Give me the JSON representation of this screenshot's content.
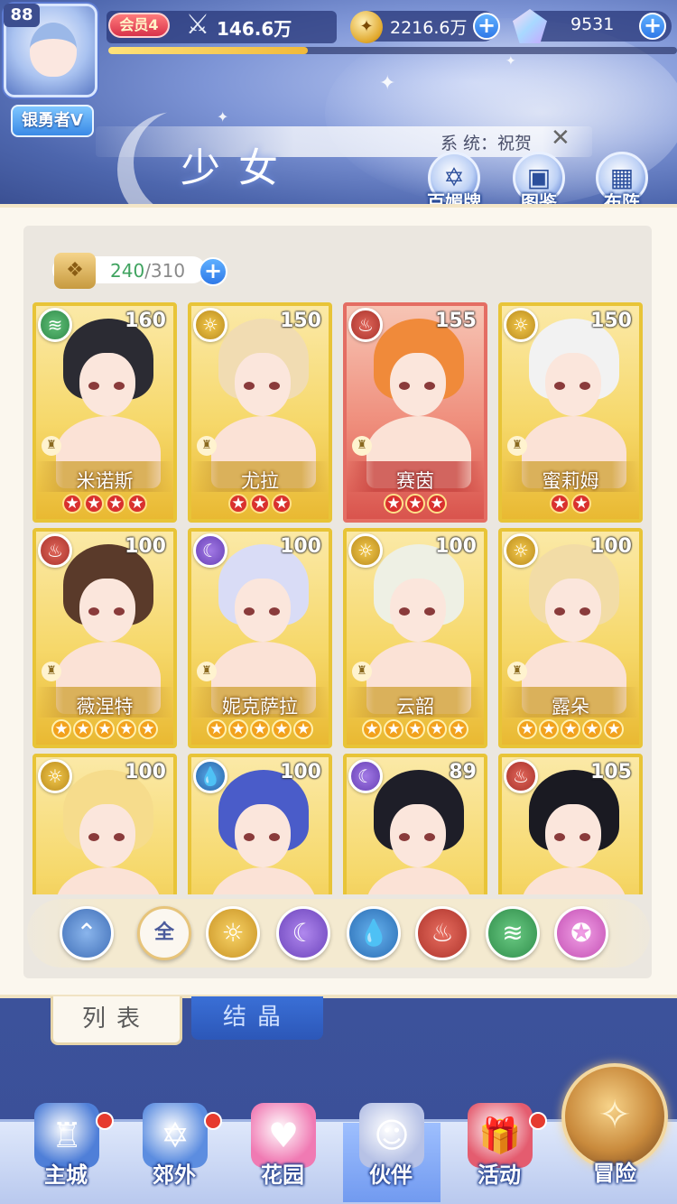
{
  "player": {
    "level": "88",
    "title": "银勇者V",
    "vip": "会员4",
    "power": "146.6万",
    "exp_fraction": 0.35
  },
  "resources": {
    "coins": "2216.6万",
    "gems": "9531",
    "plus_label": "+"
  },
  "system_message": {
    "text": "系  统：祝贺",
    "close_label": "✕"
  },
  "page_title": "少女",
  "functions": [
    {
      "label": "百媚牌",
      "icon": "hexagram-icon"
    },
    {
      "label": "图鉴",
      "icon": "book-icon"
    },
    {
      "label": "布阵",
      "icon": "grid-icon"
    }
  ],
  "capacity": {
    "current": "240",
    "max": "/310",
    "plus_label": "+"
  },
  "cards": [
    {
      "name": "米诺斯",
      "level": "160",
      "element": "wind",
      "stars": 4,
      "star_color": "red",
      "frame": "gold",
      "hair": "#2b2b33"
    },
    {
      "name": "尤拉",
      "level": "150",
      "element": "light",
      "stars": 3,
      "star_color": "red",
      "frame": "gold",
      "hair": "#f1dcb2"
    },
    {
      "name": "赛茵",
      "level": "155",
      "element": "fire",
      "stars": 3,
      "star_color": "red",
      "frame": "red",
      "hair": "#f08a3a"
    },
    {
      "name": "蜜莉姆",
      "level": "150",
      "element": "light",
      "stars": 2,
      "star_color": "red",
      "frame": "gold",
      "hair": "#f2f2f2"
    },
    {
      "name": "薇涅特",
      "level": "100",
      "element": "fire",
      "stars": 5,
      "star_color": "gold",
      "frame": "gold",
      "hair": "#5a3a2a"
    },
    {
      "name": "妮克萨拉",
      "level": "100",
      "element": "moon",
      "stars": 5,
      "star_color": "gold",
      "frame": "gold",
      "hair": "#d9dcf6"
    },
    {
      "name": "云韶",
      "level": "100",
      "element": "light",
      "stars": 5,
      "star_color": "gold",
      "frame": "gold",
      "hair": "#eef0e4"
    },
    {
      "name": "露朵",
      "level": "100",
      "element": "light",
      "stars": 5,
      "star_color": "gold",
      "frame": "gold",
      "hair": "#f2dca6"
    },
    {
      "name": "",
      "level": "100",
      "element": "light",
      "stars": 0,
      "star_color": "gold",
      "frame": "gold",
      "hair": "#f6dc8c"
    },
    {
      "name": "",
      "level": "100",
      "element": "water",
      "stars": 0,
      "star_color": "gold",
      "frame": "gold",
      "hair": "#4a5cc9"
    },
    {
      "name": "",
      "level": "89",
      "element": "moon",
      "stars": 0,
      "star_color": "gold",
      "frame": "gold",
      "hair": "#1e1e28"
    },
    {
      "name": "",
      "level": "105",
      "element": "fire",
      "stars": 0,
      "star_color": "gold",
      "frame": "gold",
      "hair": "#1a1a22"
    }
  ],
  "element_glyphs": {
    "light": "☼",
    "fire": "♨",
    "water": "💧",
    "wind": "≋",
    "moon": "☾"
  },
  "filters": [
    {
      "name": "type-filter",
      "class": "f-type",
      "glyph": "⌃"
    },
    {
      "name": "all-filter",
      "class": "f-all",
      "glyph": "全"
    },
    {
      "name": "light-filter",
      "class": "f-light",
      "glyph": "☼"
    },
    {
      "name": "moon-filter",
      "class": "f-moon",
      "glyph": "☾"
    },
    {
      "name": "water-filter",
      "class": "f-water",
      "glyph": "💧"
    },
    {
      "name": "fire-filter",
      "class": "f-fire",
      "glyph": "♨"
    },
    {
      "name": "wind-filter",
      "class": "f-wind",
      "glyph": "≋"
    },
    {
      "name": "special-filter",
      "class": "f-special",
      "glyph": "✪"
    }
  ],
  "tabs": {
    "list": "列表",
    "crystal": "结晶"
  },
  "nav": [
    {
      "label": "主城",
      "icon": "castle-icon",
      "color": "#4f7fd8",
      "dot": true
    },
    {
      "label": "郊外",
      "icon": "portal-icon",
      "color": "#5c8de0",
      "dot": true
    },
    {
      "label": "花园",
      "icon": "heart-icon",
      "color": "#f07ab3",
      "dot": false
    },
    {
      "label": "伙伴",
      "icon": "partner-icon",
      "color": "#b7c2e6",
      "dot": false,
      "active": true
    },
    {
      "label": "活动",
      "icon": "gift-icon",
      "color": "#e45c6f",
      "dot": true
    }
  ],
  "adventure": {
    "label": "冒险",
    "icon": "compass-icon"
  }
}
